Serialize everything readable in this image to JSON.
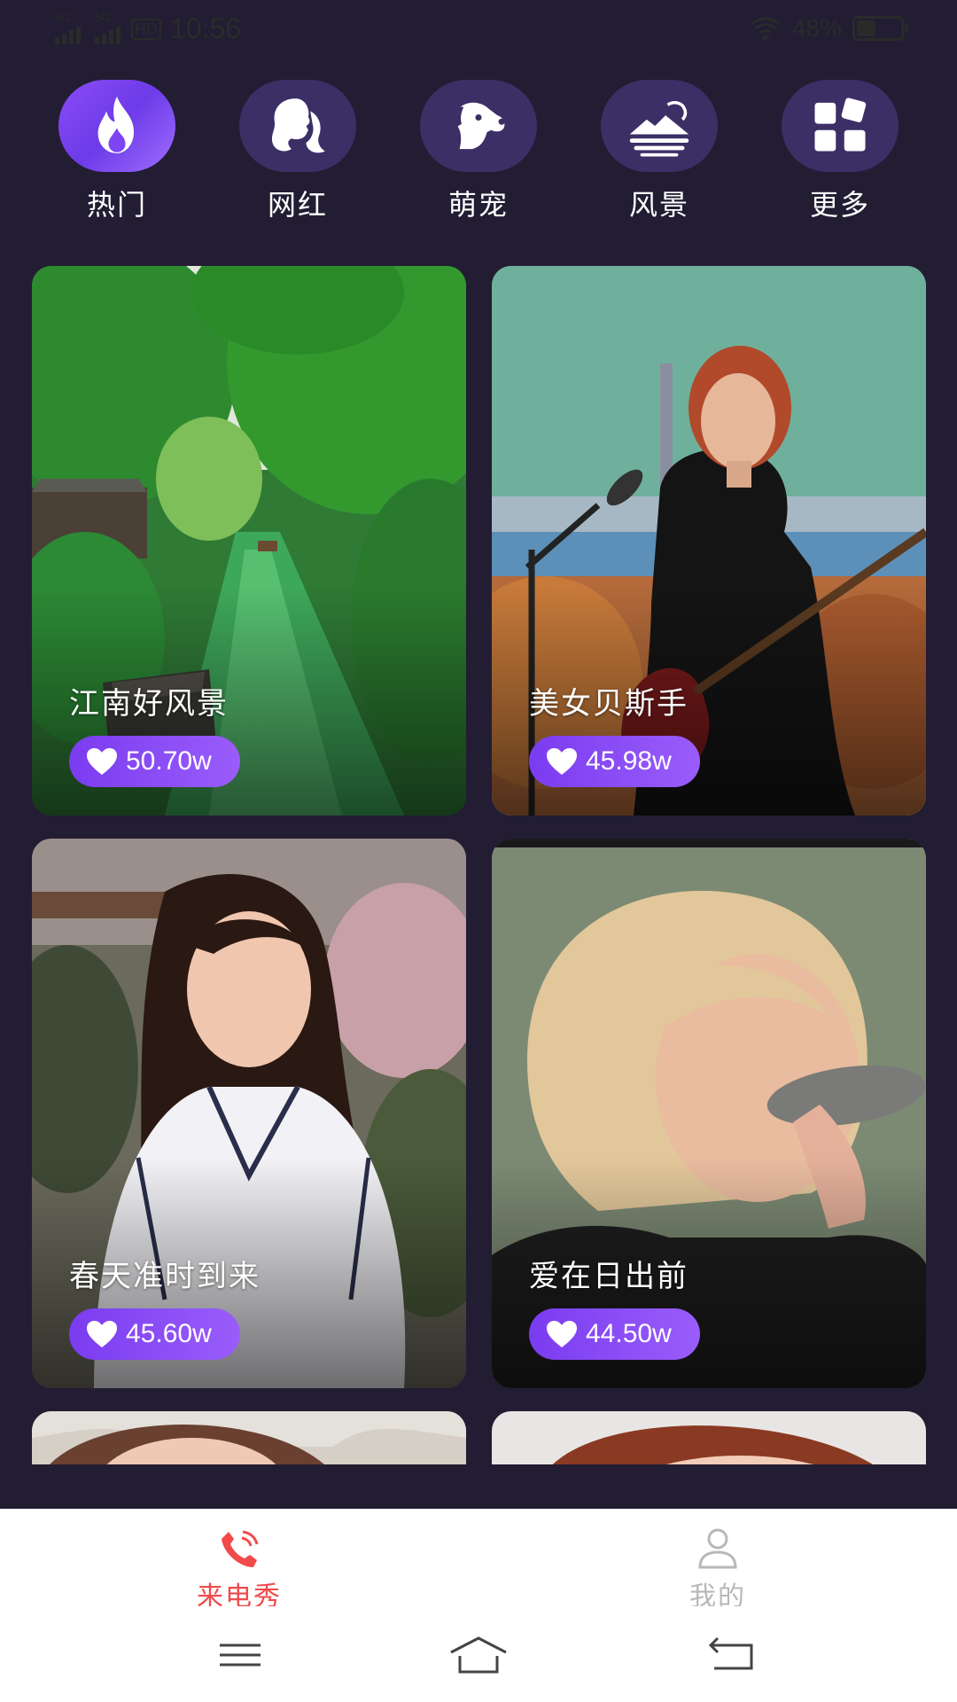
{
  "status_bar": {
    "network_1": "4G",
    "network_2": "5G",
    "hd_badge": "HD",
    "time": "10:56",
    "battery": "48%",
    "battery_level": 0.48
  },
  "categories": [
    {
      "label": "热门",
      "icon": "flame-icon",
      "active": true
    },
    {
      "label": "网红",
      "icon": "woman-profile-icon",
      "active": false
    },
    {
      "label": "萌宠",
      "icon": "dog-icon",
      "active": false
    },
    {
      "label": "风景",
      "icon": "landscape-icon",
      "active": false
    },
    {
      "label": "更多",
      "icon": "grid-more-icon",
      "active": false
    }
  ],
  "cards": [
    {
      "title": "江南好风景",
      "likes": "50.70w"
    },
    {
      "title": "美女贝斯手",
      "likes": "45.98w"
    },
    {
      "title": "春天准时到来",
      "likes": "45.60w"
    },
    {
      "title": "爱在日出前",
      "likes": "44.50w"
    }
  ],
  "tabs": [
    {
      "label": "来电秀",
      "icon": "phone-ring-icon",
      "active": true
    },
    {
      "label": "我的",
      "icon": "user-icon",
      "active": false
    }
  ],
  "colors": {
    "background": "#221d33",
    "accent": "#8a4cf7",
    "tab_active": "#f04a4a",
    "tab_inactive": "#b8b8b8"
  }
}
